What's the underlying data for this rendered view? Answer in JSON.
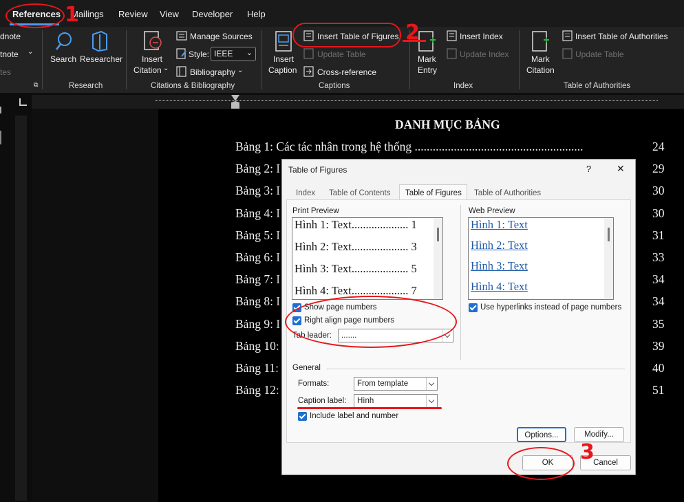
{
  "menu": {
    "tabs": [
      "References",
      "Mailings",
      "Review",
      "View",
      "Developer",
      "Help"
    ],
    "active": "References"
  },
  "ribbon": {
    "footnotes": {
      "endnote": "dnote",
      "footnote": "tnote",
      "notes": "tes"
    },
    "research": {
      "search": "Search",
      "researcher": "Researcher",
      "group": "Research"
    },
    "citations": {
      "insert_citation_1": "Insert",
      "insert_citation_2": "Citation",
      "manage_sources": "Manage Sources",
      "style_label": "Style:",
      "style_value": "IEEE",
      "bibliography": "Bibliography",
      "group": "Citations & Bibliography"
    },
    "captions": {
      "insert_caption_1": "Insert",
      "insert_caption_2": "Caption",
      "insert_tof": "Insert Table of Figures",
      "update_table": "Update Table",
      "cross_reference": "Cross-reference",
      "group": "Captions"
    },
    "index": {
      "mark_entry_1": "Mark",
      "mark_entry_2": "Entry",
      "insert_index": "Insert Index",
      "update_index": "Update Index",
      "group": "Index"
    },
    "toa": {
      "mark_citation_1": "Mark",
      "mark_citation_2": "Citation",
      "insert_toa": "Insert Table of Authorities",
      "update_table": "Update Table",
      "group": "Table of Authorities"
    }
  },
  "document": {
    "title": "DANH MỤC BẢNG",
    "entries": [
      {
        "label": "Bảng 1: Các tác nhân trong hệ thống ........................................................",
        "page": "24"
      },
      {
        "label": "Bảng 2: I",
        "page": "29"
      },
      {
        "label": "Bảng 3: I",
        "page": "30"
      },
      {
        "label": "Bảng 4: I",
        "page": "30"
      },
      {
        "label": "Bảng 5: I",
        "page": "31"
      },
      {
        "label": "Bảng 6: I",
        "page": "33"
      },
      {
        "label": "Bảng 7: I",
        "page": "34"
      },
      {
        "label": "Bảng 8: I",
        "page": "34"
      },
      {
        "label": "Bảng 9: I",
        "page": "35"
      },
      {
        "label": "Bảng 10:",
        "page": "39"
      },
      {
        "label": "Bảng 11:",
        "page": "40"
      },
      {
        "label": "Bảng 12:",
        "page": "51"
      }
    ]
  },
  "dialog": {
    "title": "Table of Figures",
    "help": "?",
    "close": "✕",
    "tabs": [
      "Index",
      "Table of Contents",
      "Table of Figures",
      "Table of Authorities"
    ],
    "active_tab": "Table of Figures",
    "print_preview_label": "Print Preview",
    "print_preview": [
      "Hình 1: Text.................... 1",
      "Hình 2: Text.................... 3",
      "Hình 3: Text.................... 5",
      "Hình 4: Text.................... 7"
    ],
    "web_preview_label": "Web Preview",
    "web_preview": [
      "Hình 1: Text",
      "Hình 2: Text",
      "Hình 3: Text",
      "Hình 4: Text"
    ],
    "show_page_numbers": "Show page numbers",
    "right_align": "Right align page numbers",
    "tab_leader_label": "Tab leader:",
    "tab_leader_value": ".......",
    "use_hyperlinks": "Use hyperlinks instead of page numbers",
    "general_label": "General",
    "formats_label": "Formats:",
    "formats_value": "From template",
    "caption_label": "Caption label:",
    "caption_value": "Hình",
    "include_label": "Include label and number",
    "options": "Options...",
    "modify": "Modify...",
    "ok": "OK",
    "cancel": "Cancel"
  },
  "annotations": [
    "1",
    "2",
    "3"
  ],
  "colors": {
    "annotation": "#e8161b",
    "accent": "#1f6fd1",
    "link": "#1e5aa8"
  }
}
